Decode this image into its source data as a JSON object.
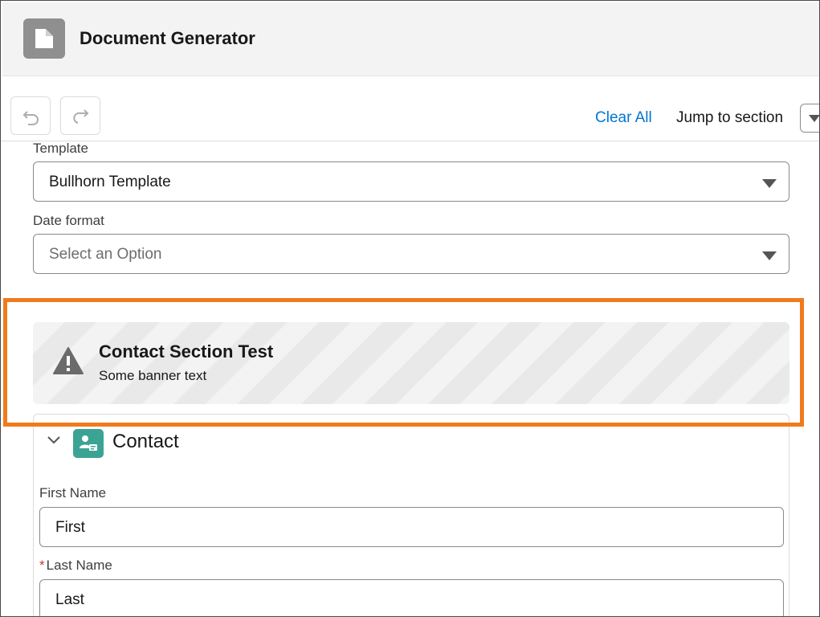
{
  "header": {
    "title": "Document Generator",
    "icon": "document-icon"
  },
  "toolbar": {
    "undo_icon": "undo-icon",
    "redo_icon": "redo-icon",
    "clear_all": "Clear All",
    "jump_to_section": "Jump to section"
  },
  "form": {
    "template": {
      "label": "Template",
      "value": "Bullhorn Template"
    },
    "date_format": {
      "label": "Date format",
      "placeholder": "Select an Option"
    }
  },
  "banner": {
    "title": "Contact Section Test",
    "text": "Some banner text",
    "icon": "warning-icon",
    "highlight_color": "#f07b1c"
  },
  "contact_section": {
    "title": "Contact",
    "icon": "contact-icon",
    "icon_color": "#3ba394",
    "fields": [
      {
        "label": "First Name",
        "value": "First",
        "required": false
      },
      {
        "label": "Last Name",
        "value": "Last",
        "required": true,
        "required_marker": "*"
      }
    ]
  },
  "colors": {
    "link": "#0176d3",
    "required": "#c23934"
  }
}
